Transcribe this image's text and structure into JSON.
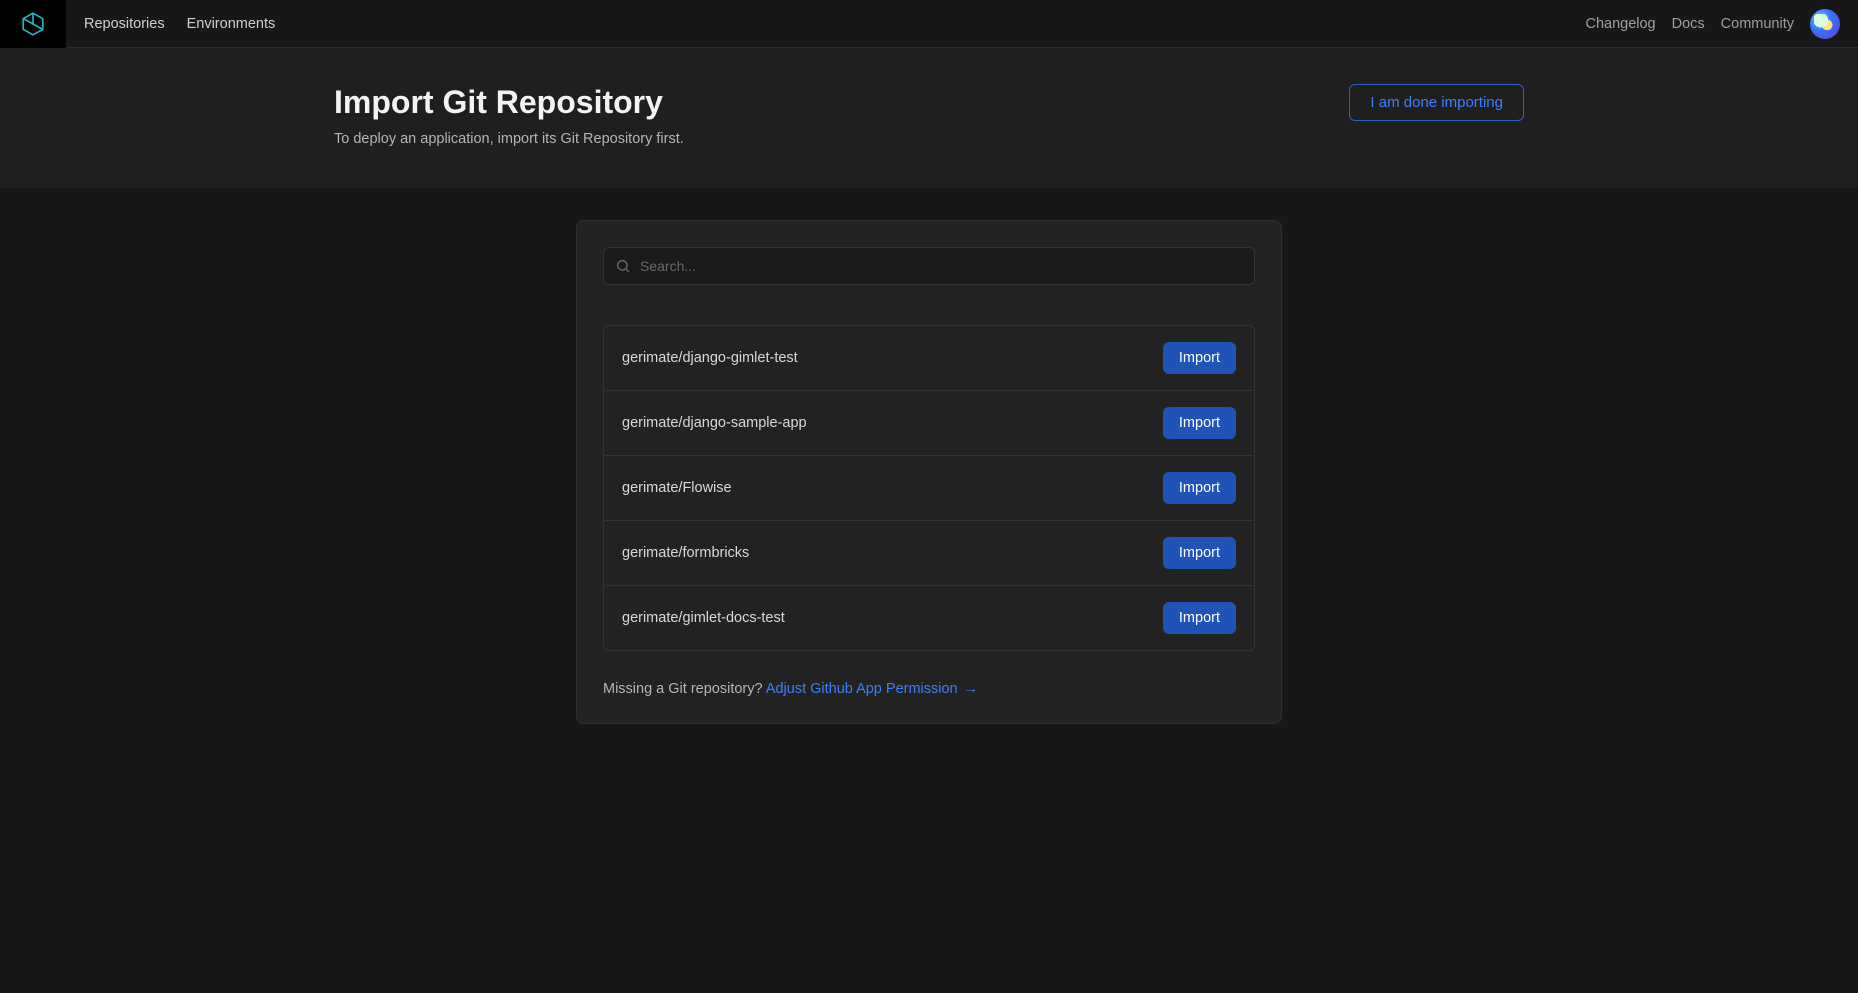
{
  "nav": {
    "left": [
      "Repositories",
      "Environments"
    ],
    "right": [
      "Changelog",
      "Docs",
      "Community"
    ]
  },
  "hero": {
    "title": "Import Git Repository",
    "subtitle": "To deploy an application, import its Git Repository first.",
    "done_label": "I am done importing"
  },
  "search": {
    "placeholder": "Search..."
  },
  "repos": [
    {
      "name": "gerimate/django-gimlet-test"
    },
    {
      "name": "gerimate/django-sample-app"
    },
    {
      "name": "gerimate/Flowise"
    },
    {
      "name": "gerimate/formbricks"
    },
    {
      "name": "gerimate/gimlet-docs-test"
    }
  ],
  "import_label": "Import",
  "missing": {
    "text": "Missing a Git repository? ",
    "link": "Adjust Github App Permission",
    "arrow": "→"
  }
}
